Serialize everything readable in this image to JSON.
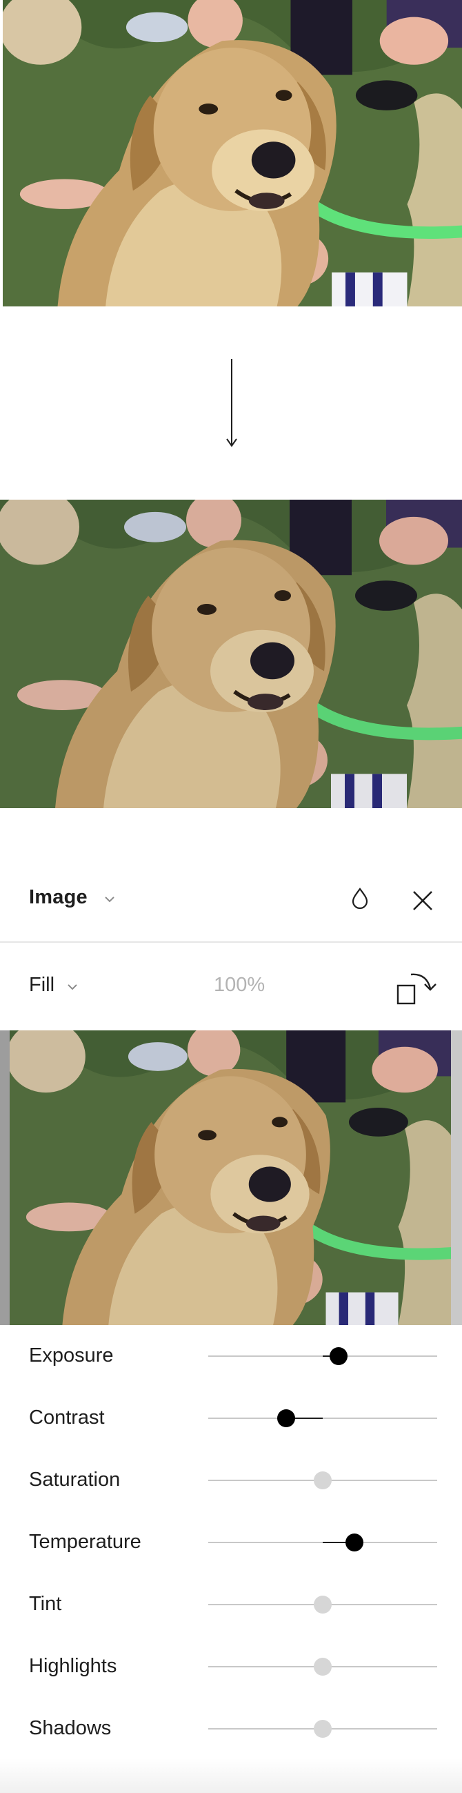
{
  "preview": {
    "before_image": "dog-photo",
    "after_image": "dog-photo-adjusted",
    "arrow_icon": "arrow-down-icon"
  },
  "panel": {
    "title": "Image",
    "title_chevron_icon": "chevron-down-icon",
    "style_icon": "droplet-icon",
    "close_icon": "close-icon",
    "fill": {
      "label": "Fill",
      "chevron_icon": "chevron-down-icon",
      "opacity": "100%",
      "rotate_icon": "rotate-icon"
    },
    "image_thumbnail": "dog-photo",
    "adjustments": [
      {
        "label": "Exposure",
        "value": 0.57,
        "active": true
      },
      {
        "label": "Contrast",
        "value": 0.34,
        "active": true
      },
      {
        "label": "Saturation",
        "value": 0.5,
        "active": false
      },
      {
        "label": "Temperature",
        "value": 0.64,
        "active": true
      },
      {
        "label": "Tint",
        "value": 0.5,
        "active": false
      },
      {
        "label": "Highlights",
        "value": 0.5,
        "active": false
      },
      {
        "label": "Shadows",
        "value": 0.5,
        "active": false
      }
    ]
  },
  "colors": {
    "text": "#1e1e1e",
    "muted_text": "#b3b3b3",
    "track": "#c8c8c8",
    "thumb_active": "#000000",
    "thumb_inactive": "#d6d6d6",
    "divider": "#e6e6e6",
    "leash_green": "#5fe17a"
  }
}
